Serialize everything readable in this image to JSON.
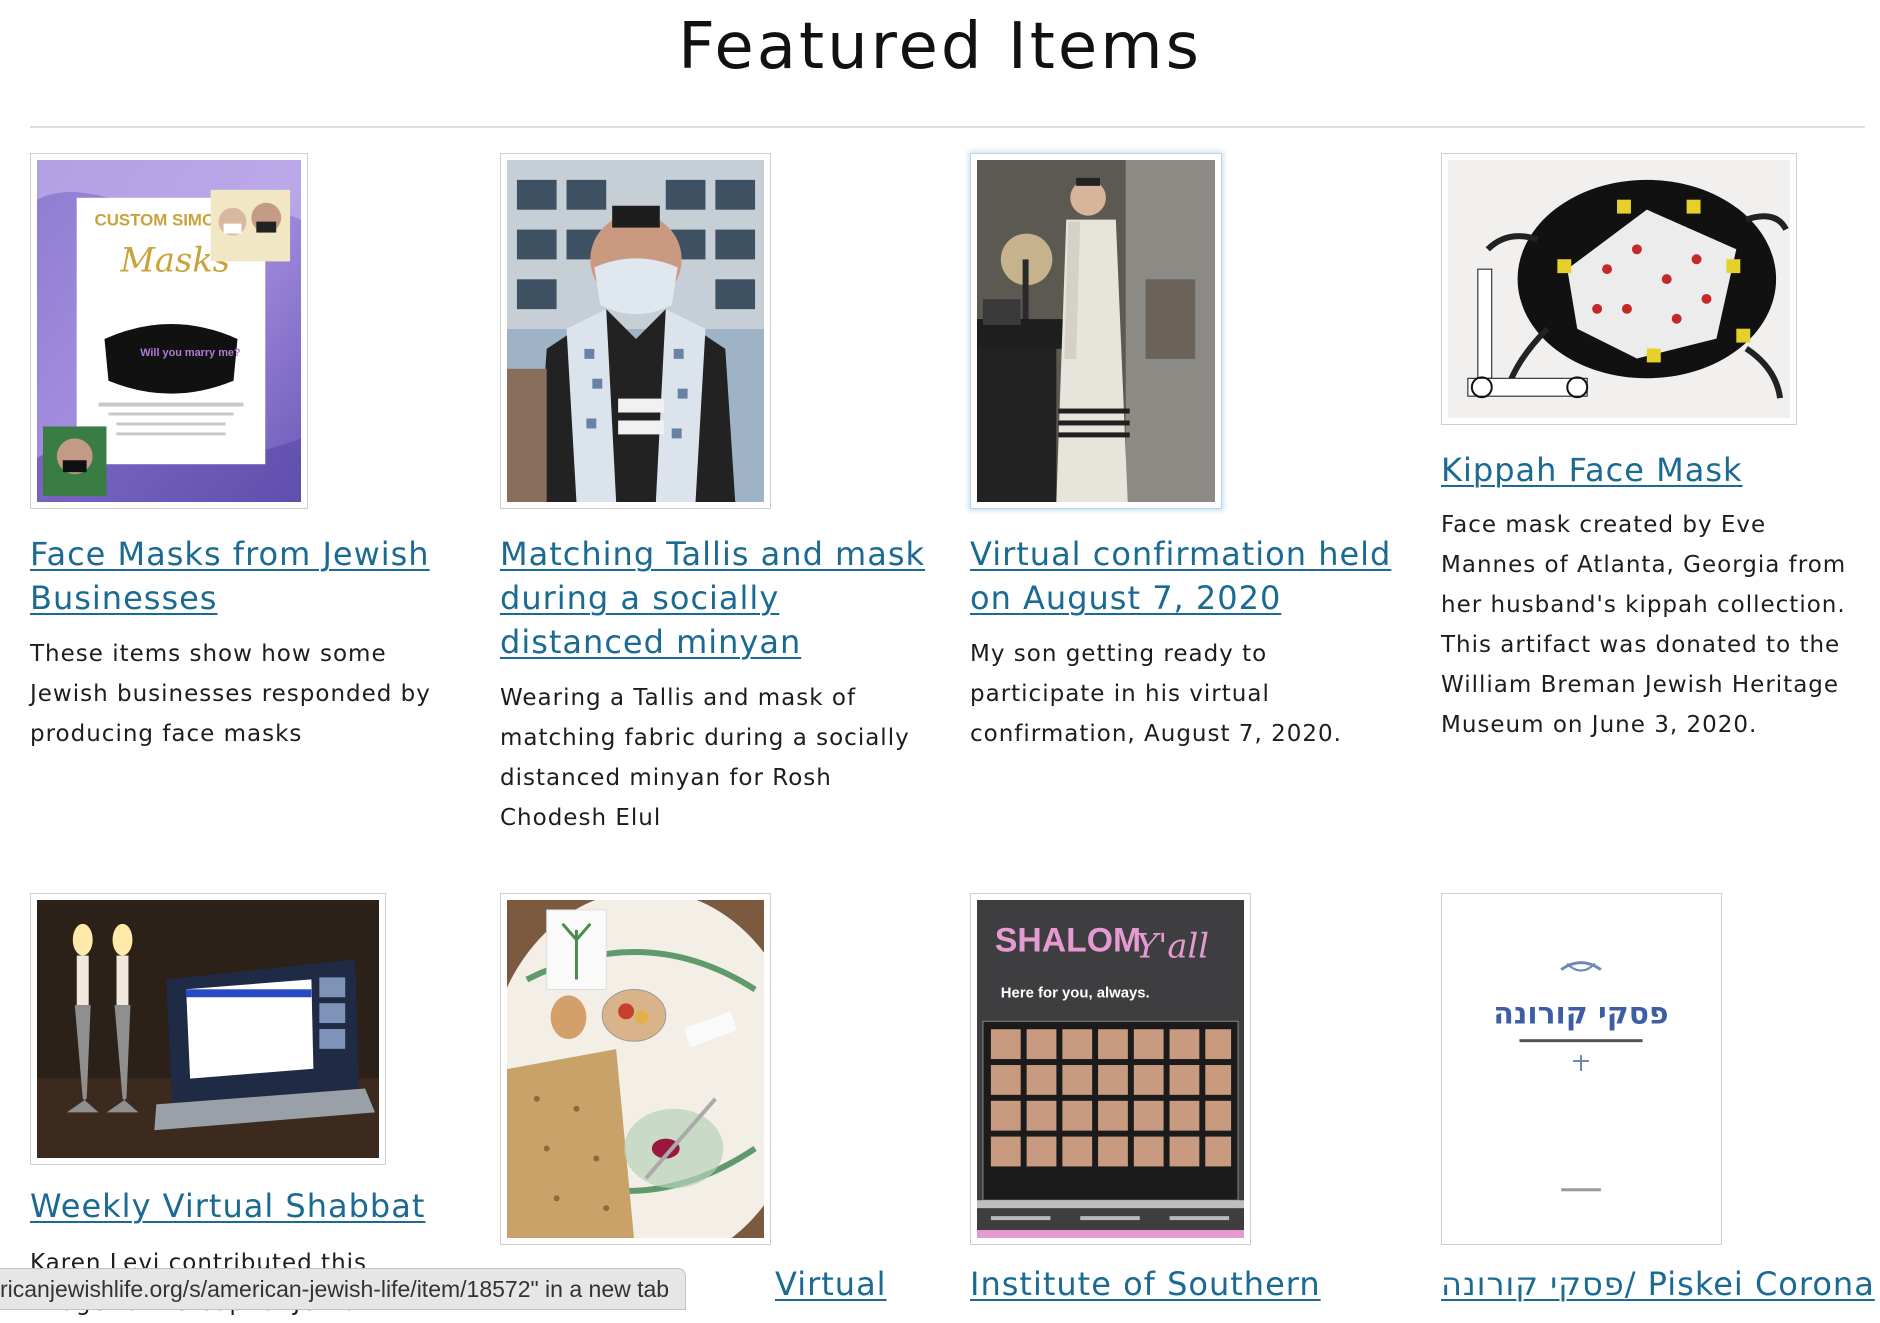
{
  "page": {
    "heading": "Featured Items"
  },
  "items": [
    {
      "title": "Face Masks from Jewish Businesses",
      "description": "These items show how some Jewish businesses responded by producing face masks",
      "image": "custom-simcha-masks-flyer"
    },
    {
      "title": "Matching Tallis and mask during a socially distanced minyan",
      "description": "Wearing a Tallis and mask of matching fabric during a socially distanced minyan for Rosh Chodesh Elul",
      "image": "man-in-tallis-and-mask-photo"
    },
    {
      "title": "Virtual confirmation held on August 7, 2020",
      "description": "My son getting ready to participate in his virtual confirmation, August 7, 2020.",
      "image": "son-at-laptop-in-tallis-photo"
    },
    {
      "title": "Kippah Face Mask",
      "description": "Face mask created by Eve Mannes of Atlanta, Georgia from her husband's kippah collection. This artifact was donated to the William Breman Jewish Heritage Museum on June 3, 2020.",
      "image": "kippah-face-mask-photo"
    },
    {
      "title": "Weekly Virtual Shabbat",
      "description": "Karen Levi contributed this image to the Capital Jewish Museum's",
      "image": "shabbat-candles-laptop-photo"
    },
    {
      "title": "Virtual",
      "description": "",
      "image": "seder-plate-photo"
    },
    {
      "title": "Institute of Southern",
      "description": "",
      "image": "shalom-yall-magazine-cover"
    },
    {
      "title": "פסקי קורונה/ Piskei Corona",
      "description": "",
      "image": "piskei-corona-booklet-cover"
    }
  ],
  "image_text": {
    "custom_simcha_line1": "CUSTOM SIMCHA",
    "custom_simcha_line2": "Masks",
    "custom_simcha_question": "Will you marry me?",
    "shalom_title": "SHALOM",
    "shalom_script": "Y'all",
    "shalom_tagline": "Here for you, always.",
    "piskei_title": "פסקי קורונה"
  },
  "statusbar": {
    "text": "ricanjewishlife.org/s/american-jewish-life/item/18572\" in a new tab"
  },
  "colors": {
    "link": "#1b6a94",
    "rule": "#dedede",
    "thumb_border": "#cfcfcf"
  }
}
